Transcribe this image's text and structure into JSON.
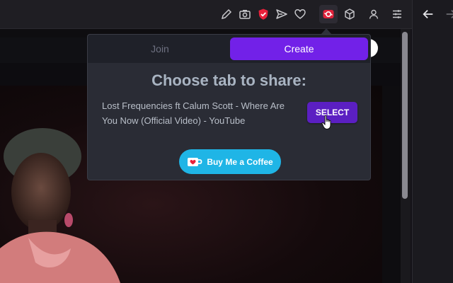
{
  "toolbar": {
    "icons": [
      "edit-icon",
      "camera-icon",
      "shield-icon",
      "send-icon",
      "heart-icon",
      "extension-share-icon",
      "cube-icon",
      "profile-icon",
      "menu-icon"
    ]
  },
  "side_panel": {
    "icons": [
      "back-arrow-icon",
      "forward-arrow-icon"
    ]
  },
  "popup": {
    "tabs": [
      {
        "label": "Join",
        "active": false
      },
      {
        "label": "Create",
        "active": true
      }
    ],
    "title": "Choose tab to share:",
    "tab_title": "Lost Frequencies ft Calum Scott - Where Are You Now (Official Video) - YouTube",
    "select_label": "SELECT",
    "coffee_label": "Buy Me a Coffee"
  },
  "colors": {
    "accent": "#7221e8",
    "select_bg": "#5b1fc2",
    "coffee_bg": "#1fb5e6",
    "shield_red": "#e8213b"
  }
}
